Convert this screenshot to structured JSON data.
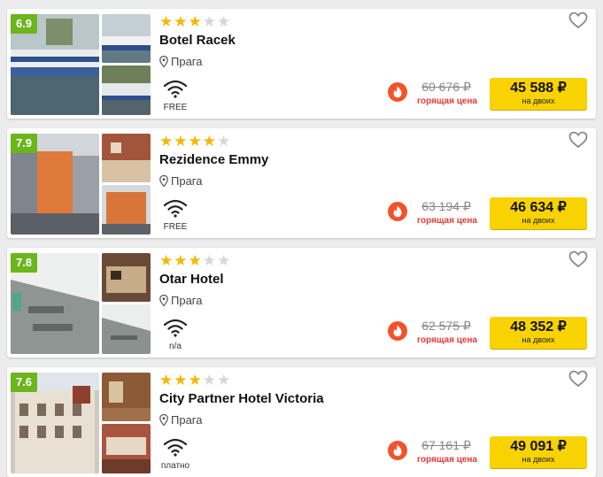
{
  "hotels": [
    {
      "rating": "6.9",
      "stars": 3,
      "name": "Botel Racek",
      "city": "Прага",
      "wifi": "FREE",
      "old_price": "60 676 ₽",
      "hot_label": "горящая цена",
      "price": "45 588 ₽",
      "price_note": "на двоих"
    },
    {
      "rating": "7.9",
      "stars": 4,
      "name": "Rezidence Emmy",
      "city": "Прага",
      "wifi": "FREE",
      "old_price": "63 194 ₽",
      "hot_label": "горящая цена",
      "price": "46 634 ₽",
      "price_note": "на двоих"
    },
    {
      "rating": "7.8",
      "stars": 3,
      "name": "Otar Hotel",
      "city": "Прага",
      "wifi": "n/a",
      "old_price": "62 575 ₽",
      "hot_label": "горящая цена",
      "price": "48 352 ₽",
      "price_note": "на двоих"
    },
    {
      "rating": "7.6",
      "stars": 3,
      "name": "City Partner Hotel Victoria",
      "city": "Прага",
      "wifi": "платно",
      "old_price": "67 161 ₽",
      "hot_label": "горящая цена",
      "price": "49 091 ₽",
      "price_note": "на двоих"
    }
  ],
  "icons": {
    "location": "map-pin-icon",
    "wifi": "wifi-icon",
    "hot": "fire-icon",
    "favorite": "heart-icon",
    "star": "star-icon"
  },
  "colors": {
    "rating_badge": "#6cb51e",
    "star": "#f5b700",
    "price_button": "#f9d300",
    "hot": "#e53935"
  }
}
